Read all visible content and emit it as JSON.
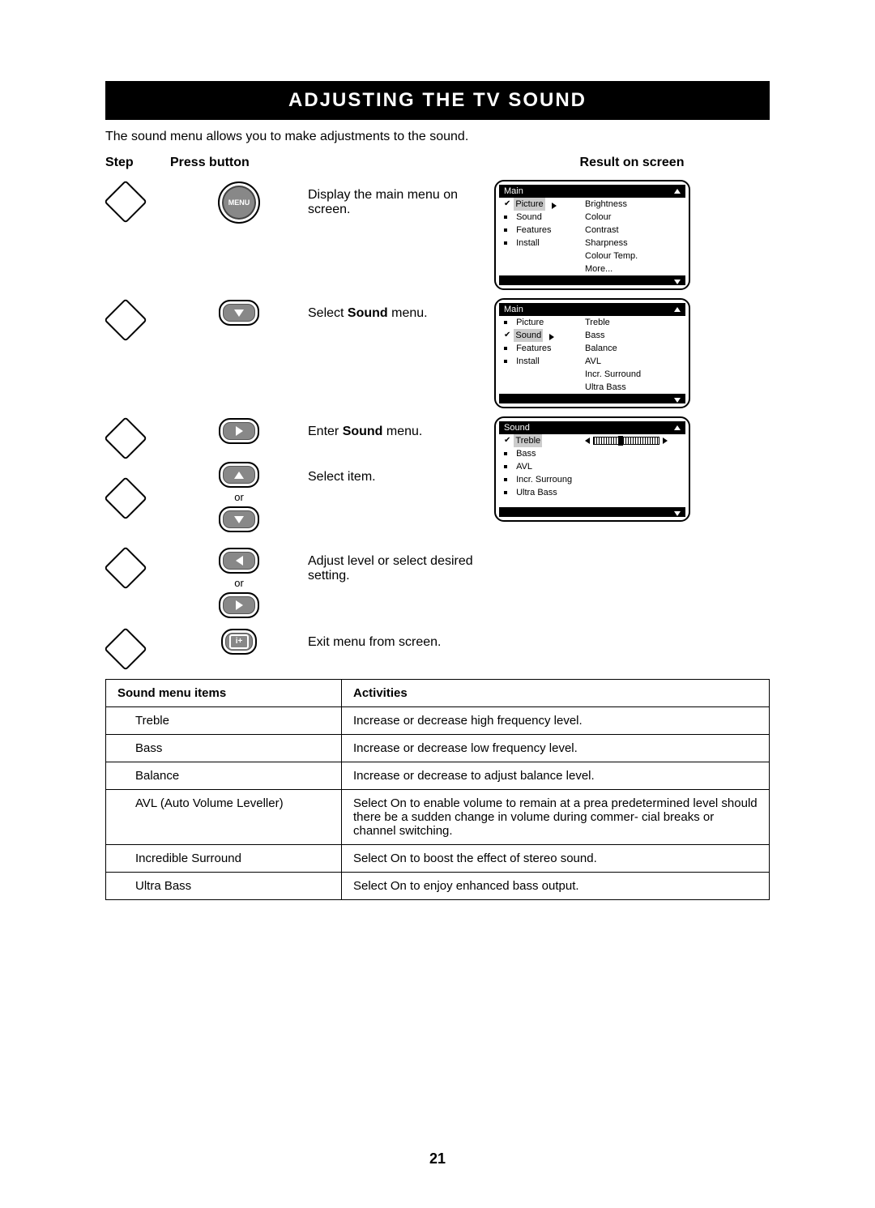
{
  "title": "ADJUSTING THE TV SOUND",
  "intro": "The sound menu allows you to make adjustments to the sound.",
  "headers": {
    "step": "Step",
    "press": "Press button",
    "result": "Result on screen"
  },
  "steps": {
    "s1": {
      "button": "MENU",
      "desc_pre": "Display the main menu on screen."
    },
    "s2": {
      "desc_pre": "Select ",
      "desc_bold": "Sound",
      "desc_post": " menu."
    },
    "s3": {
      "desc_pre": "Enter ",
      "desc_bold": "Sound",
      "desc_post": " menu."
    },
    "s4": {
      "or": "or",
      "desc": "Select item."
    },
    "s5": {
      "or": "or",
      "desc": "Adjust level or select desired setting."
    },
    "s6": {
      "desc": "Exit menu from screen."
    }
  },
  "osd1": {
    "title": "Main",
    "left": [
      "Picture",
      "Sound",
      "Features",
      "Install"
    ],
    "right": [
      "Brightness",
      "Colour",
      "Contrast",
      "Sharpness",
      "Colour Temp.",
      "More..."
    ]
  },
  "osd2": {
    "title": "Main",
    "left": [
      "Picture",
      "Sound",
      "Features",
      "Install"
    ],
    "right": [
      "Treble",
      "Bass",
      "Balance",
      "AVL",
      "Incr. Surround",
      "Ultra Bass"
    ]
  },
  "osd3": {
    "title": "Sound",
    "left": [
      "Treble",
      "Bass",
      "AVL",
      "Incr. Surroung",
      "Ultra Bass"
    ]
  },
  "tableHeaders": {
    "col1": "Sound menu items",
    "col2": "Activities"
  },
  "tableRows": [
    {
      "item": "Treble",
      "act": "Increase or decrease high frequency level."
    },
    {
      "item": "Bass",
      "act": "Increase or decrease low frequency level."
    },
    {
      "item": "Balance",
      "act": "Increase or decrease to adjust balance level."
    },
    {
      "item": "AVL (Auto Volume Leveller)",
      "act": "Select On to enable volume to remain at a prea predetermined level should there be a sudden change  in volume during commer- cial breaks or  channel switching."
    },
    {
      "item": "Incredible Surround",
      "act": "Select On to boost the effect of stereo sound."
    },
    {
      "item": "Ultra Bass",
      "act": "Select On to enjoy enhanced bass output."
    }
  ],
  "pageNumber": "21"
}
